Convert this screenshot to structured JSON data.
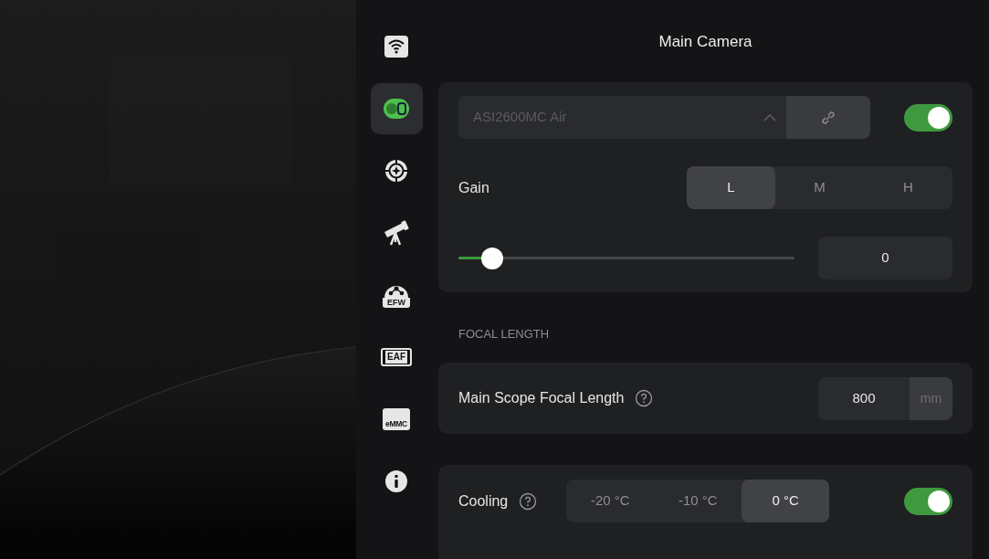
{
  "sidebar": {
    "items": [
      {
        "kind": "wifi",
        "selected": false
      },
      {
        "kind": "camera",
        "selected": true
      },
      {
        "kind": "guide",
        "selected": false
      },
      {
        "kind": "telescope",
        "selected": false
      },
      {
        "kind": "filter_wheel",
        "label": "EFW",
        "selected": false
      },
      {
        "kind": "focuser",
        "label": "EAF",
        "selected": false
      },
      {
        "kind": "storage",
        "label": "eMMC",
        "selected": false
      },
      {
        "kind": "info",
        "selected": false
      }
    ]
  },
  "panel": {
    "title": "Main Camera",
    "camera_card": {
      "device": "ASI2600MC Air",
      "enabled": true,
      "gain_label": "Gain",
      "gain_modes": [
        {
          "label": "L",
          "selected": true
        },
        {
          "label": "M",
          "selected": false
        },
        {
          "label": "H",
          "selected": false
        }
      ],
      "gain_slider": {
        "level": 0.1
      },
      "gain_value": "0"
    },
    "focal_section": {
      "heading": "FOCAL LENGTH",
      "label": "Main Scope Focal Length",
      "value": "800",
      "unit": "mm"
    },
    "cooling_card": {
      "label": "Cooling",
      "on": true,
      "temperatures": [
        {
          "label": "-20 °C",
          "selected": false
        },
        {
          "label": "-10 °C",
          "selected": false
        },
        {
          "label": "0 °C",
          "selected": true
        }
      ]
    }
  }
}
